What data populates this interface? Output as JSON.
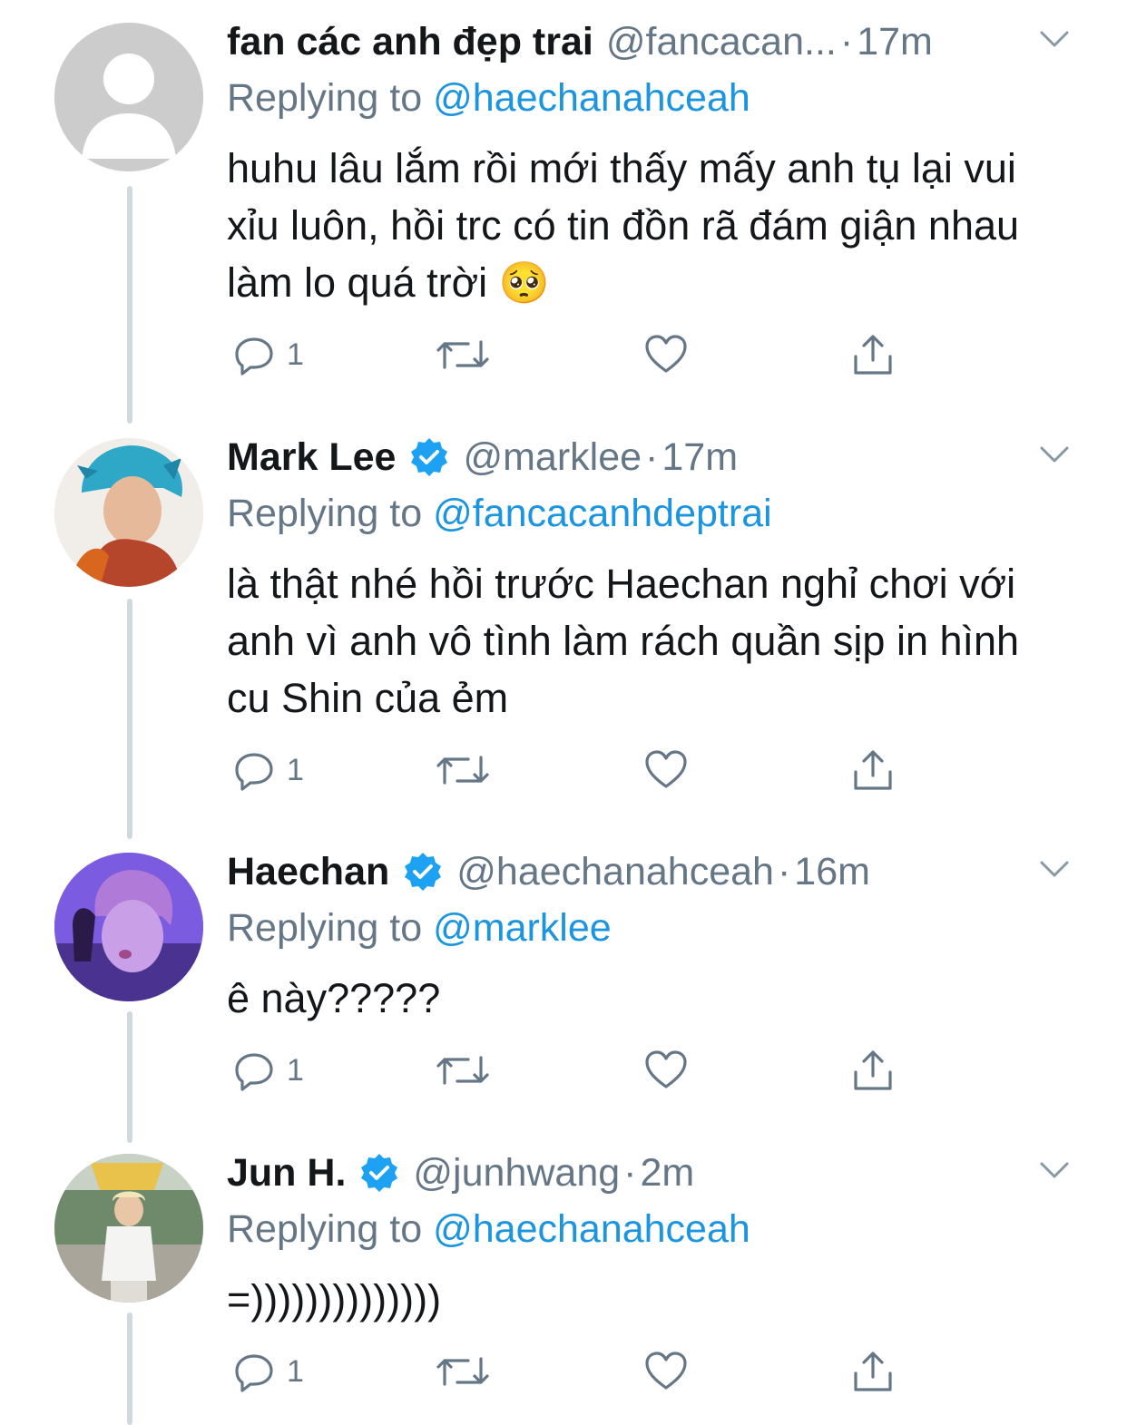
{
  "tweets": [
    {
      "name": "fan các anh đẹp trai",
      "handle": "@fancacan...",
      "time": "17m",
      "verified": false,
      "replying_prefix": "Replying to",
      "replying_to": "@haechanahceah",
      "text": "huhu lâu lắm rồi mới thấy mấy anh tụ lại vui xỉu luôn, hồi trc có tin đồn rã đám giận nhau làm lo quá trời",
      "emoji": "🥺",
      "reply_count": "1",
      "avatar_icon": "default-profile-icon"
    },
    {
      "name": "Mark Lee",
      "handle": "@marklee",
      "time": "17m",
      "verified": true,
      "replying_prefix": "Replying to",
      "replying_to": "@fancacanhdeptrai",
      "text": "là thật nhé hồi trước Haechan nghỉ chơi với anh vì anh vô tình làm rách quần sịp in hình cu Shin của ẻm",
      "reply_count": "1",
      "avatar_icon": "profile-photo"
    },
    {
      "name": "Haechan",
      "handle": "@haechanahceah",
      "time": "16m",
      "verified": true,
      "replying_prefix": "Replying to",
      "replying_to": "@marklee",
      "text": "ê này?????",
      "reply_count": "1",
      "avatar_icon": "profile-photo"
    },
    {
      "name": "Jun H.",
      "handle": "@junhwang",
      "time": "2m",
      "verified": true,
      "replying_prefix": "Replying to",
      "replying_to": "@haechanahceah",
      "text": "=))))))))))))))",
      "reply_count": "1",
      "avatar_icon": "profile-photo"
    }
  ],
  "separator": "·",
  "colors": {
    "text": "#14171a",
    "secondary": "#657786",
    "link": "#1b95e0",
    "verified": "#1da1f2",
    "thread_line": "#cfd9de"
  }
}
